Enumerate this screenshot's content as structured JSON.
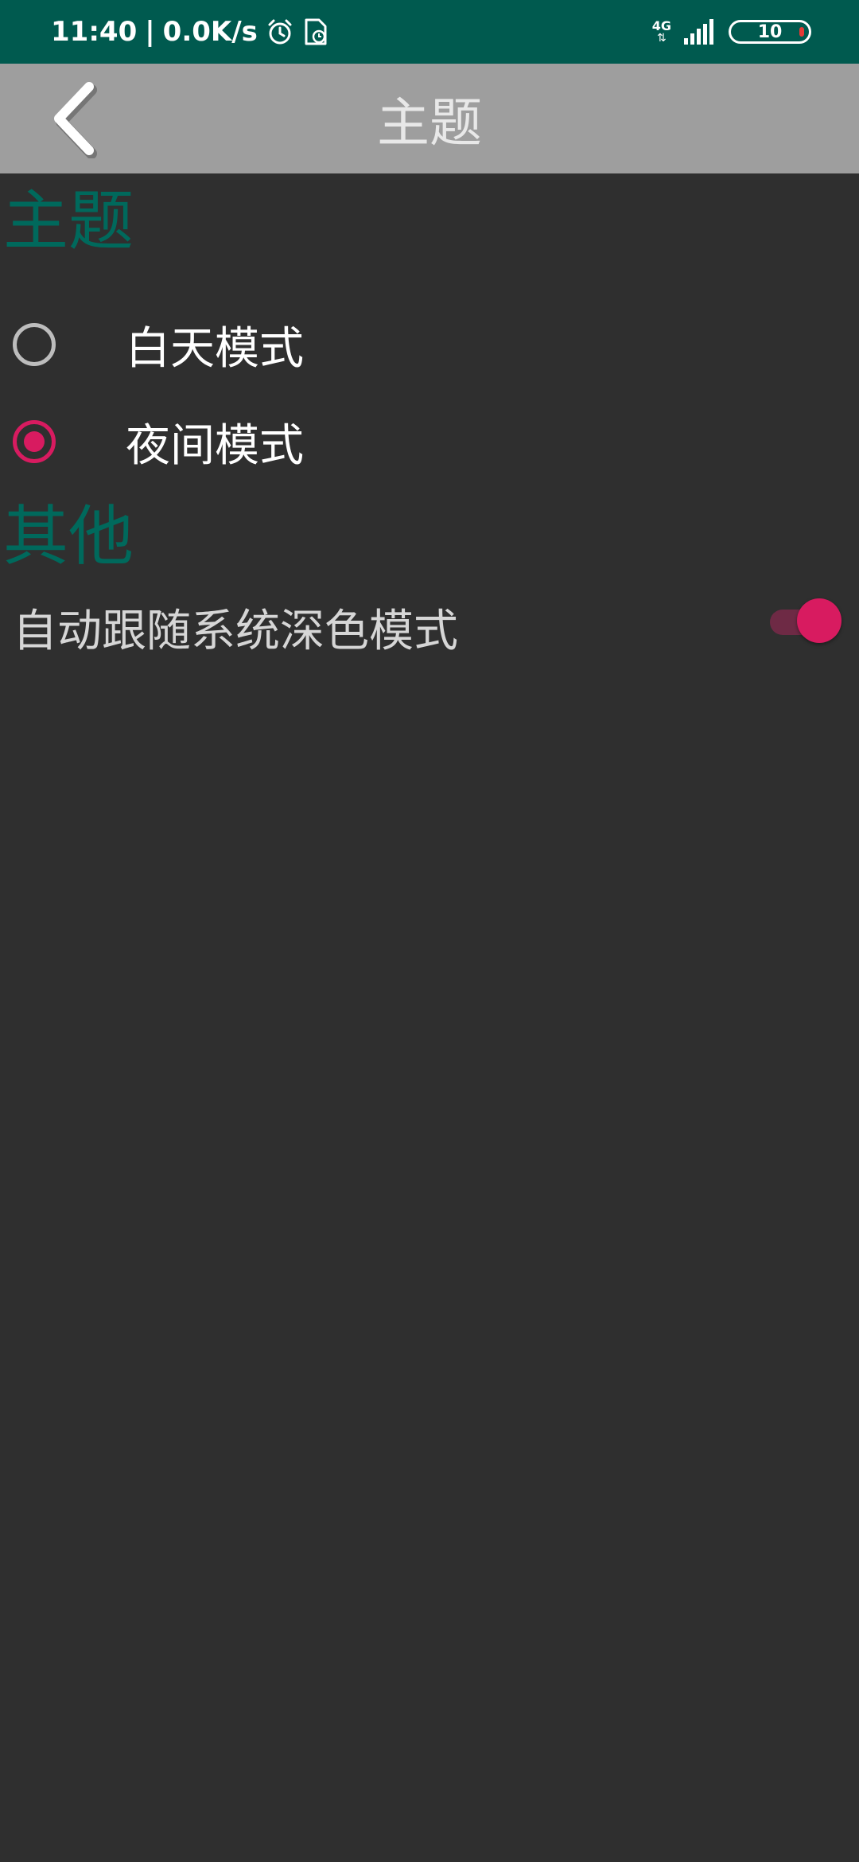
{
  "status_bar": {
    "time": "11:40",
    "separator": "|",
    "network_speed": "0.0K/s",
    "network_type": "4G",
    "battery": "10",
    "icons": [
      "alarm-icon",
      "sim-timer-icon",
      "signal-icon",
      "battery-icon"
    ]
  },
  "app_bar": {
    "title": "主题",
    "back_icon": "chevron-left-icon"
  },
  "sections": {
    "theme": {
      "header": "主题",
      "options": [
        {
          "label": "白天模式",
          "selected": false
        },
        {
          "label": "夜间模式",
          "selected": true
        }
      ]
    },
    "other": {
      "header": "其他",
      "follow_system_dark_mode": {
        "label": "自动跟随系统深色模式",
        "enabled": true
      }
    }
  },
  "colors": {
    "status_bar": "#005a4f",
    "app_bar": "#9e9e9e",
    "background": "#2f2f2f",
    "section_header": "#00695c",
    "accent": "#d81b60"
  }
}
